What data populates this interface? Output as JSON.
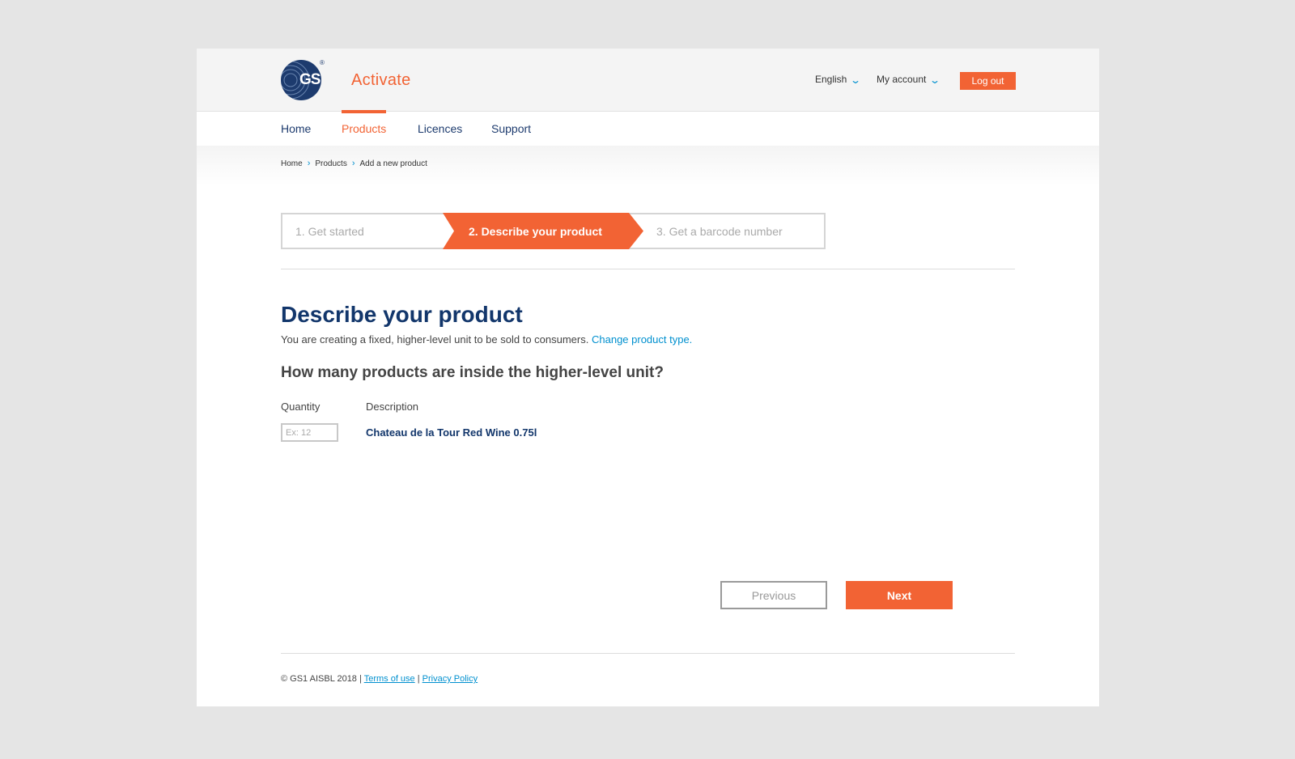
{
  "header": {
    "logo_text": "GS1",
    "logo_reg": "®",
    "app_name": "Activate",
    "language": "English",
    "account": "My account",
    "logout_label": "Log out"
  },
  "nav": {
    "items": [
      {
        "label": "Home",
        "active": false
      },
      {
        "label": "Products",
        "active": true
      },
      {
        "label": "Licences",
        "active": false
      },
      {
        "label": "Support",
        "active": false
      }
    ]
  },
  "breadcrumb": [
    "Home",
    "Products",
    "Add a new product"
  ],
  "stepper": {
    "steps": [
      {
        "label": "1. Get started",
        "state": "done"
      },
      {
        "label": "2. Describe your product",
        "state": "active"
      },
      {
        "label": "3. Get a barcode number",
        "state": "upcoming"
      }
    ]
  },
  "main": {
    "title": "Describe your product",
    "subtitle": "You are creating a fixed, higher-level unit to be sold to consumers.",
    "change_link": "Change product type.",
    "question": "How many products are inside the higher-level unit?",
    "quantity_label": "Quantity",
    "description_label": "Description",
    "quantity_placeholder": "Ex: 12",
    "quantity_value": "",
    "description_value": "Chateau de la Tour Red Wine 0.75l"
  },
  "actions": {
    "previous_label": "Previous",
    "next_label": "Next"
  },
  "footer": {
    "copyright": "© GS1 AISBL 2018 |",
    "terms": "Terms of use",
    "divider": "|",
    "privacy": "Privacy Policy"
  },
  "colors": {
    "accent": "#f26334",
    "brand_navy": "#12366b",
    "link_blue": "#0090cf",
    "page_bg": "#e5e5e5"
  }
}
